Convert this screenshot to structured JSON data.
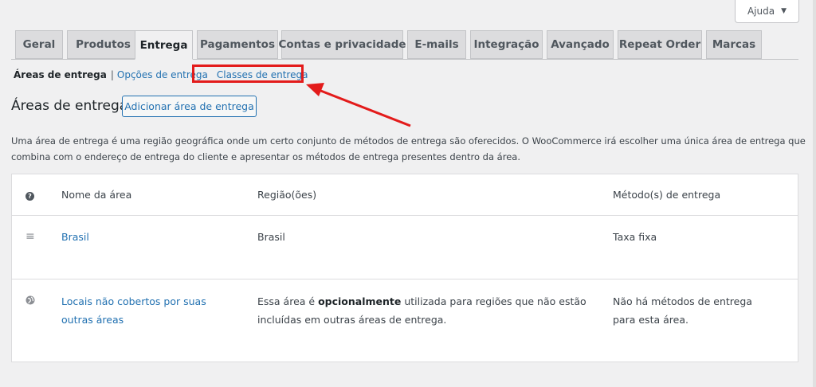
{
  "help": {
    "label": "Ajuda",
    "caret": "▼"
  },
  "tabs": [
    {
      "label": "Geral"
    },
    {
      "label": "Produtos"
    },
    {
      "label": "Entrega"
    },
    {
      "label": "Pagamentos"
    },
    {
      "label": "Contas e privacidade"
    },
    {
      "label": "E-mails"
    },
    {
      "label": "Integração"
    },
    {
      "label": "Avançado"
    },
    {
      "label": "Repeat Order"
    },
    {
      "label": "Marcas"
    }
  ],
  "active_tab": "Entrega",
  "subnav": {
    "current": "Áreas de entrega",
    "separator": "|",
    "options": "Opções de entrega",
    "classes": "Classes de entrega"
  },
  "page": {
    "title": "Áreas de entrega",
    "add_button": "Adicionar área de entrega",
    "description": "Uma área de entrega é uma região geográfica onde um certo conjunto de métodos de entrega são oferecidos. O WooCommerce irá escolher uma única área de entrega que combina com o endereço de entrega do cliente e apresentar os métodos de entrega presentes dentro da área."
  },
  "table": {
    "headers": {
      "icon": "?",
      "name": "Nome da área",
      "region": "Região(ões)",
      "method": "Método(s) de entrega"
    },
    "rows": [
      {
        "icon": "drag-handle-icon",
        "name": "Brasil",
        "region": "Brasil",
        "method": "Taxa fixa"
      }
    ],
    "other": {
      "icon": "globe-icon",
      "name": "Locais não cobertos por suas outras áreas",
      "region_prefix": "Essa área é ",
      "region_bold": "opcionalmente",
      "region_suffix": " utilizada para regiões que não estão incluídas em outras áreas de entrega.",
      "method": "Não há métodos de entrega para esta área."
    }
  },
  "annotation": {
    "color": "#e31b1b"
  }
}
